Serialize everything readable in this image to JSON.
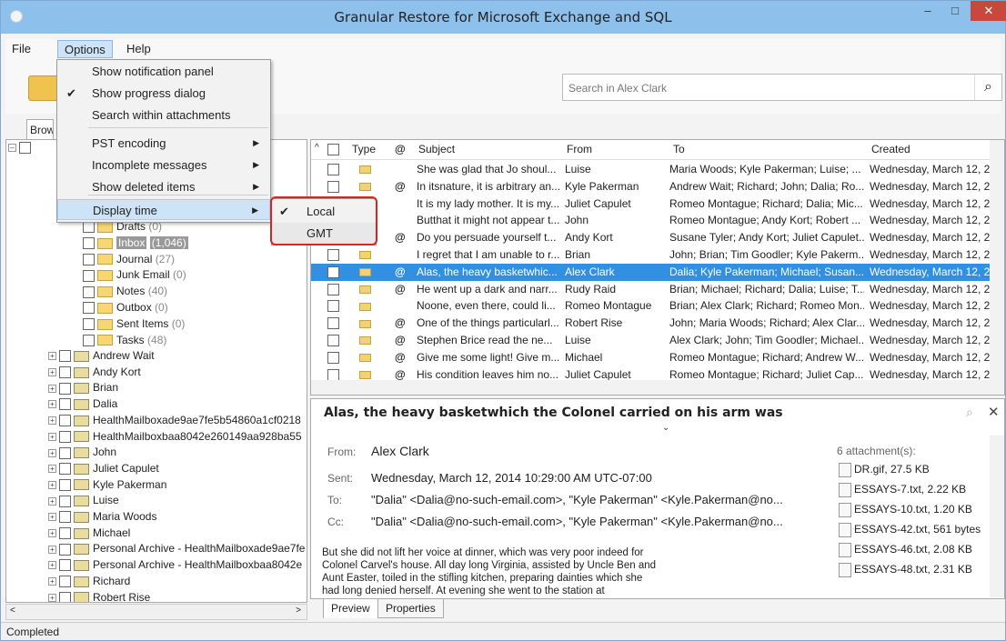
{
  "window": {
    "title": "Granular Restore for Microsoft Exchange and SQL",
    "minimize": "–",
    "maximize": "□",
    "close": "✕"
  },
  "menubar": {
    "file": "File",
    "options": "Options",
    "help": "Help"
  },
  "options_menu": {
    "items": [
      {
        "label": "Show notification panel",
        "checked": false
      },
      {
        "label": "Show progress dialog",
        "checked": true
      },
      {
        "label": "Search within attachments",
        "checked": false
      },
      {
        "label": "PST encoding",
        "submenu": true
      },
      {
        "label": "Incomplete messages",
        "submenu": true
      },
      {
        "label": "Show deleted items",
        "submenu": true
      },
      {
        "label": "Display time",
        "submenu": true
      }
    ],
    "check": "✔",
    "arrow": "▶"
  },
  "display_time_submenu": {
    "local": "Local",
    "gmt": "GMT",
    "check": "✔"
  },
  "search": {
    "placeholder": "Search in Alex Clark",
    "icon": "⌕"
  },
  "browse_tab": "Brow",
  "tree": {
    "folders": [
      {
        "label": "Drafts",
        "count": "(0)"
      },
      {
        "label": "Inbox",
        "count": "(1,046)"
      },
      {
        "label": "Journal",
        "count": "(27)"
      },
      {
        "label": "Junk Email",
        "count": "(0)"
      },
      {
        "label": "Notes",
        "count": "(40)"
      },
      {
        "label": "Outbox",
        "count": "(0)"
      },
      {
        "label": "Sent Items",
        "count": "(0)"
      },
      {
        "label": "Tasks",
        "count": "(48)"
      }
    ],
    "mailboxes": [
      "Andrew Wait",
      "Andy Kort",
      "Brian",
      "Dalia",
      "HealthMailboxade9ae7fe5b54860a1cf0218",
      "HealthMailboxbaa8042e260149aa928ba55",
      "John",
      "Juliet Capulet",
      "Kyle Pakerman",
      "Luise",
      "Maria Woods",
      "Michael",
      "Personal Archive - HealthMailboxade9ae7fe",
      "Personal Archive - HealthMailboxbaa8042e",
      "Richard",
      "Robert Rise"
    ]
  },
  "grid": {
    "headers": {
      "type": "Type",
      "subject": "Subject",
      "from": "From",
      "to": "To",
      "created": "Created"
    },
    "rows": [
      {
        "subject": "She was glad that Jo shoul...",
        "from": "Luise",
        "to": "Maria Woods; Kyle Pakerman; Luise; ...",
        "created": "Wednesday, March 12, 2",
        "att": false
      },
      {
        "subject": "In itsnature, it is arbitrary an...",
        "from": "Kyle Pakerman",
        "to": "Andrew Wait; Richard; John; Dalia; Ro...",
        "created": "Wednesday, March 12, 2",
        "att": true
      },
      {
        "subject": "It is my lady mother.  It is my...",
        "from": "Juliet Capulet",
        "to": "Romeo Montague; Richard; Dalia; Mic...",
        "created": "Wednesday, March 12, 2",
        "att": false
      },
      {
        "subject": "Butthat it might not appear t...",
        "from": "John",
        "to": "Romeo Montague; Andy Kort; Robert ...",
        "created": "Wednesday, March 12, 2",
        "att": false
      },
      {
        "subject": "Do you persuade yourself t...",
        "from": "Andy Kort",
        "to": "Susane Tyler; Andy Kort; Juliet Capulet...",
        "created": "Wednesday, March 12, 2",
        "att": true
      },
      {
        "subject": "I regret that I am unable to r...",
        "from": "Brian",
        "to": "John; Brian; Tim Goodler; Kyle Pakerm...",
        "created": "Wednesday, March 12, 2",
        "att": false
      },
      {
        "subject": "Alas, the heavy basketwhic...",
        "from": "Alex Clark",
        "to": "Dalia; Kyle Pakerman; Michael; Susan...",
        "created": "Wednesday, March 12, 2",
        "att": true,
        "selected": true
      },
      {
        "subject": "He went up a dark and narr...",
        "from": "Rudy Raid",
        "to": "Brian; Michael; Richard; Dalia; Luise; T...",
        "created": "Wednesday, March 12, 2",
        "att": true
      },
      {
        "subject": "Noone, even there, could li...",
        "from": "Romeo Montague",
        "to": "Brian; Alex Clark; Richard; Romeo Mon...",
        "created": "Wednesday, March 12, 2",
        "att": false
      },
      {
        "subject": "One of the things particularl...",
        "from": "Robert Rise",
        "to": "John; Maria Woods; Richard; Alex Clar...",
        "created": "Wednesday, March 12, 2",
        "att": true
      },
      {
        "subject": "Stephen Brice read the ne...",
        "from": "Luise",
        "to": "Alex Clark; John; Tim Goodler; Michael...",
        "created": "Wednesday, March 12, 2",
        "att": true
      },
      {
        "subject": "Give me some light! Give m...",
        "from": "Michael",
        "to": "Romeo Montague; Richard; Andrew W...",
        "created": "Wednesday, March 12, 2",
        "att": true
      },
      {
        "subject": "His condition leaves him no...",
        "from": "Juliet Capulet",
        "to": "Romeo Montague; Richard; Juliet Cap...",
        "created": "Wednesday, March 12, 2",
        "att": true
      }
    ]
  },
  "preview": {
    "subject": "Alas, the heavy basketwhich the Colonel carried on his arm was",
    "from_label": "From:",
    "from": "Alex Clark",
    "sent_label": "Sent:",
    "sent": "Wednesday, March 12, 2014 10:29:00 AM UTC-07:00",
    "to_label": "To:",
    "to": "\"Dalia\" <Dalia@no-such-email.com>, \"Kyle Pakerman\" <Kyle.Pakerman@no...",
    "cc_label": "Cc:",
    "cc": "\"Dalia\" <Dalia@no-such-email.com>, \"Kyle Pakerman\" <Kyle.Pakerman@no...",
    "attachments_title": "6 attachment(s):",
    "attachments": [
      "DR.gif, 27.5 KB",
      "ESSAYS-7.txt, 2.22 KB",
      "ESSAYS-10.txt, 1.20 KB",
      "ESSAYS-42.txt, 561 bytes",
      "ESSAYS-46.txt, 2.08 KB",
      "ESSAYS-48.txt, 2.31 KB"
    ],
    "body": "But she did not lift her voice at dinner, which was very poor indeed for Colonel Carvel's house. All day long Virginia, assisted by Uncle Ben and Aunt Easter, toiled in the stifling kitchen, preparing dainties which she had long denied herself. At evening she went to the station at",
    "tab_preview": "Preview",
    "tab_properties": "Properties"
  },
  "status": {
    "text": "Completed"
  },
  "colors": {
    "selection": "#3390e0",
    "titlebar": "#8ec0ec",
    "close": "#c9483c",
    "highlight": "#cde3f7",
    "outline": "#dd2222"
  }
}
